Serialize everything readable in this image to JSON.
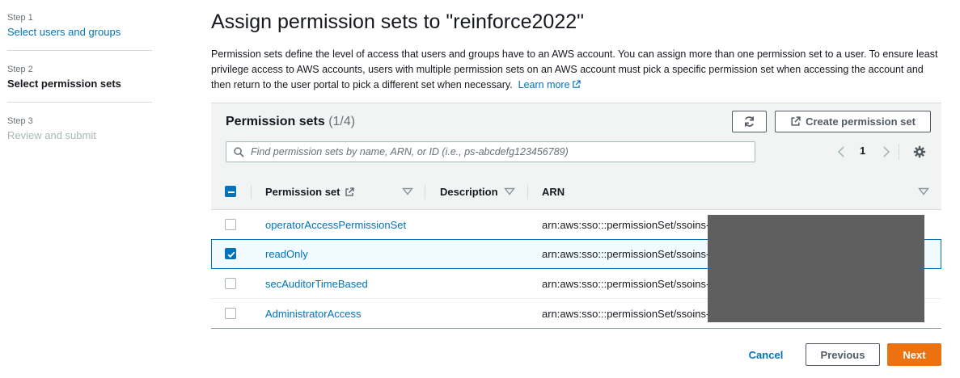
{
  "steps": [
    {
      "num": "Step 1",
      "title": "Select users and groups",
      "state": "link"
    },
    {
      "num": "Step 2",
      "title": "Select permission sets",
      "state": "current"
    },
    {
      "num": "Step 3",
      "title": "Review and submit",
      "state": "disabled"
    }
  ],
  "page": {
    "title": "Assign permission sets to \"reinforce2022\"",
    "description": "Permission sets define the level of access that users and groups have to an AWS account. You can assign more than one permission set to a user. To ensure least privilege access to AWS accounts, users with multiple permission sets on an AWS account must pick a specific permission set when accessing the account and then return to the user portal to pick a different set when necessary.",
    "learn_more": "Learn more"
  },
  "panel": {
    "title": "Permission sets",
    "count": "(1/4)",
    "refresh_icon": "refresh-icon",
    "create_label": "Create permission set",
    "search_placeholder": "Find permission sets by name, ARN, or ID (i.e., ps-abcdefg123456789)",
    "page_number": "1"
  },
  "table": {
    "columns": {
      "name": "Permission set",
      "description": "Description",
      "arn": "ARN"
    },
    "rows": [
      {
        "name": "operatorAccessPermissionSet",
        "arn": "arn:aws:sso:::permissionSet/ssoins-",
        "selected": false
      },
      {
        "name": "readOnly",
        "arn": "arn:aws:sso:::permissionSet/ssoins-",
        "selected": true
      },
      {
        "name": "secAuditorTimeBased",
        "arn": "arn:aws:sso:::permissionSet/ssoins-",
        "selected": false
      },
      {
        "name": "AdministratorAccess",
        "arn": "arn:aws:sso:::permissionSet/ssoins-",
        "selected": false
      }
    ]
  },
  "footer": {
    "cancel": "Cancel",
    "previous": "Previous",
    "next": "Next"
  },
  "colors": {
    "accent": "#0073bb",
    "primary_button": "#ec7211",
    "redaction": "#5f5f5f"
  }
}
